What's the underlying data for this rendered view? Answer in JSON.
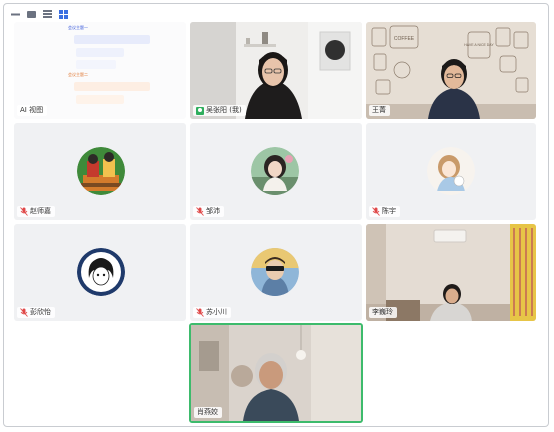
{
  "toolbar": {
    "buttons": [
      "minimize-view",
      "speaker-view",
      "list-view",
      "grid-view"
    ]
  },
  "whiteboard": {
    "section1": "会议主题一",
    "section2": "会议主题二",
    "label": "AI 视图"
  },
  "participants": [
    {
      "name": "吴张阳 (我)",
      "muted": false,
      "video": true
    },
    {
      "name": "王菁",
      "muted": false,
      "video": true
    },
    {
      "name": "赵师嘉",
      "muted": true,
      "video": false
    },
    {
      "name": "邹沛",
      "muted": true,
      "video": false
    },
    {
      "name": "陈宇",
      "muted": true,
      "video": false
    },
    {
      "name": "彭欣怡",
      "muted": true,
      "video": false
    },
    {
      "name": "苏小川",
      "muted": true,
      "video": false
    },
    {
      "name": "李巍玲",
      "muted": false,
      "video": true
    },
    {
      "name": "肖燕姣",
      "muted": false,
      "video": true,
      "active_speaker": true
    }
  ],
  "scene_text": {
    "coffee_sign": "COFFEE",
    "wall_sign": "HAVE A NICE DAY"
  },
  "colors": {
    "active_border": "#3dbb6c",
    "mute_red": "#e04848",
    "tile_bg": "#f0f1f3"
  }
}
